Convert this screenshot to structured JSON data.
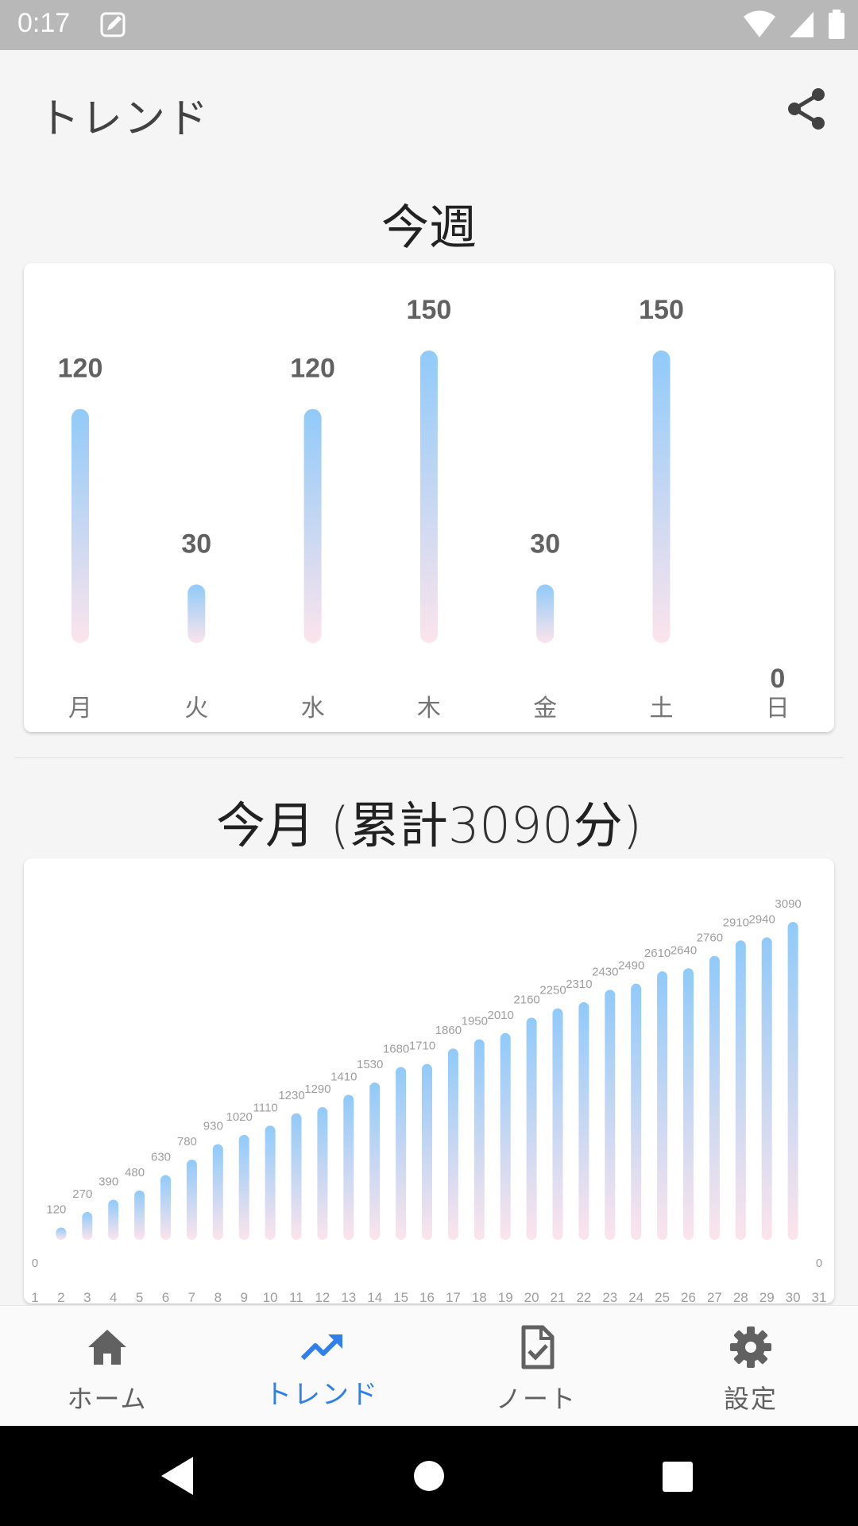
{
  "status_bar": {
    "time": "0:17",
    "icons": [
      "note-edit-icon",
      "wifi-icon",
      "cell-signal-icon",
      "battery-icon"
    ]
  },
  "app_bar": {
    "title": "トレンド",
    "share_icon": "share-icon"
  },
  "week": {
    "title": "今週"
  },
  "month": {
    "title_prefix": "今月 ",
    "paren_open": "(",
    "total_label": "累計",
    "total_value": "3090",
    "total_unit": "分",
    "paren_close": ")"
  },
  "colors": {
    "bar_top": "#90caf9",
    "bar_bottom": "#fce4ec",
    "active": "#2f80ed",
    "inactive": "#616161"
  },
  "chart_data": [
    {
      "type": "bar",
      "categories": [
        "月",
        "火",
        "水",
        "木",
        "金",
        "土",
        "日"
      ],
      "values": [
        120,
        30,
        120,
        150,
        30,
        150,
        0
      ],
      "ylim": [
        0,
        150
      ]
    },
    {
      "type": "bar",
      "categories": [
        "1",
        "2",
        "3",
        "4",
        "5",
        "6",
        "7",
        "8",
        "9",
        "10",
        "11",
        "12",
        "13",
        "14",
        "15",
        "16",
        "17",
        "18",
        "19",
        "20",
        "21",
        "22",
        "23",
        "24",
        "25",
        "26",
        "27",
        "28",
        "29",
        "30",
        "31"
      ],
      "values": [
        0,
        120,
        270,
        390,
        480,
        630,
        780,
        930,
        1020,
        1110,
        1230,
        1290,
        1410,
        1530,
        1680,
        1710,
        1860,
        1950,
        2010,
        2160,
        2250,
        2310,
        2430,
        2490,
        2610,
        2640,
        2760,
        2910,
        2940,
        3090,
        0
      ],
      "ylim": [
        0,
        3090
      ]
    }
  ],
  "bottom_nav": {
    "items": [
      {
        "label": "ホーム",
        "icon": "home-icon"
      },
      {
        "label": "トレンド",
        "icon": "trending-up-icon"
      },
      {
        "label": "ノート",
        "icon": "note-check-icon"
      },
      {
        "label": "設定",
        "icon": "gear-icon"
      }
    ],
    "active_index": 1
  },
  "system_nav": {
    "icons": [
      "back-icon",
      "home-circle-icon",
      "recents-icon"
    ]
  }
}
